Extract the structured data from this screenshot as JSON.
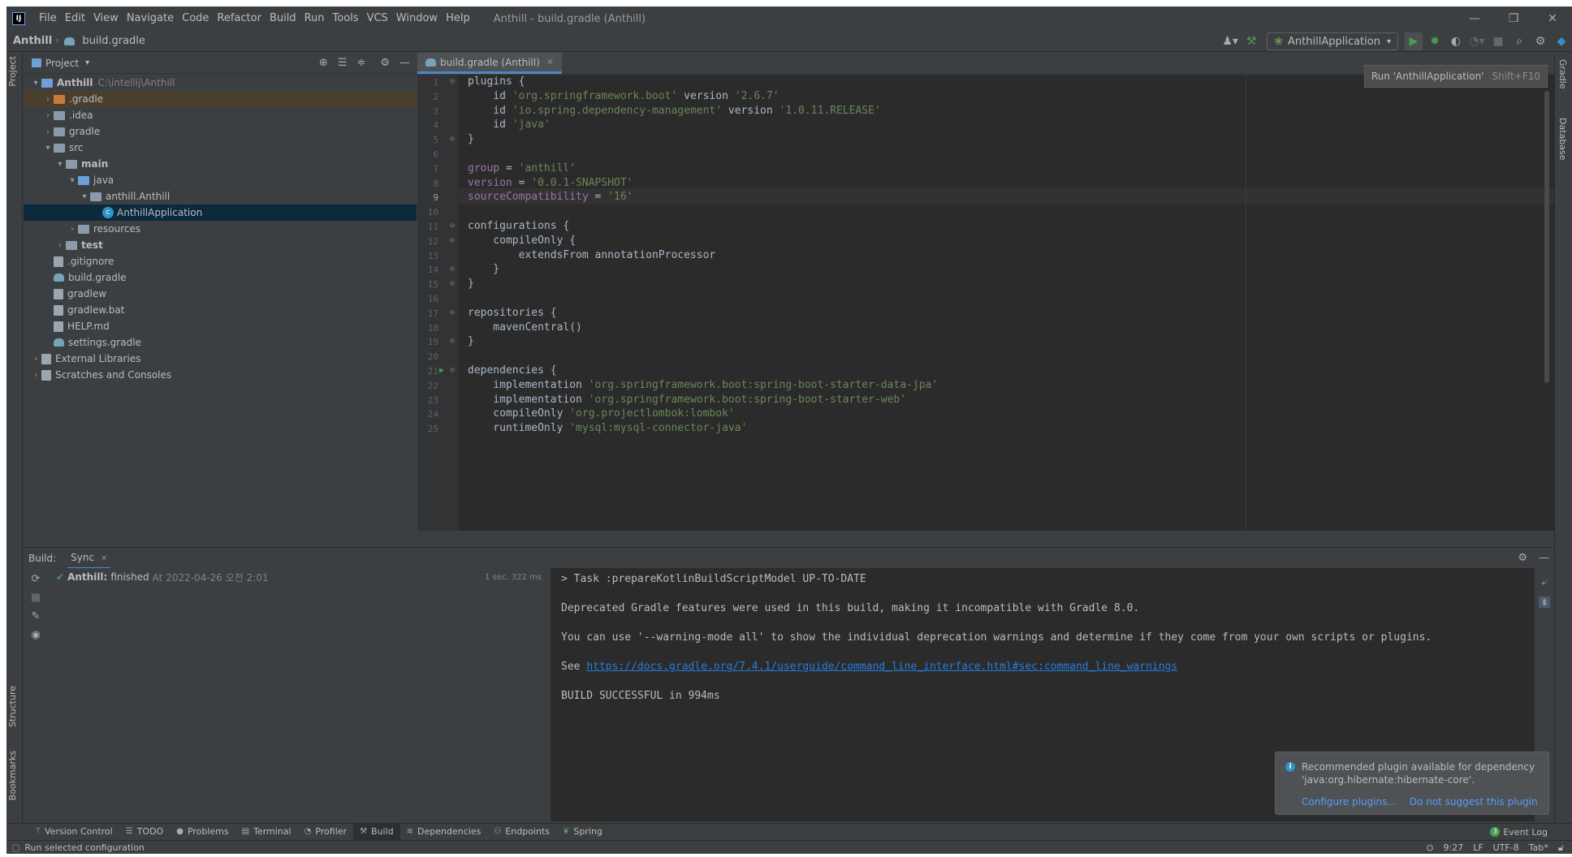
{
  "menubar": {
    "logo": "IJ",
    "items": [
      "File",
      "Edit",
      "View",
      "Navigate",
      "Code",
      "Refactor",
      "Build",
      "Run",
      "Tools",
      "VCS",
      "Window",
      "Help"
    ],
    "window_title": "Anthill - build.gradle (Anthill)",
    "controls": [
      "—",
      "❐",
      "✕"
    ]
  },
  "navbar": {
    "project": "Anthill",
    "file": "build.gradle",
    "run_config": "AnthillApplication"
  },
  "tooltip": {
    "text": "Run 'AnthillApplication'",
    "shortcut": "Shift+F10"
  },
  "left_stripe": [
    "Project",
    "Structure",
    "Bookmarks"
  ],
  "right_stripe": [
    "Gradle",
    "Database"
  ],
  "project_panel": {
    "title": "Project",
    "tree": [
      {
        "label": "Anthill",
        "extra": "C:\\intellij\\Anthill",
        "depth": 0,
        "arrow": "▾",
        "icon": "module",
        "bold": true
      },
      {
        "label": ".gradle",
        "depth": 1,
        "arrow": "›",
        "icon": "folder-orange",
        "hl": true
      },
      {
        "label": ".idea",
        "depth": 1,
        "arrow": "›",
        "icon": "folder"
      },
      {
        "label": "gradle",
        "depth": 1,
        "arrow": "›",
        "icon": "folder"
      },
      {
        "label": "src",
        "depth": 1,
        "arrow": "▾",
        "icon": "folder"
      },
      {
        "label": "main",
        "depth": 2,
        "arrow": "▾",
        "icon": "folder",
        "bold": true
      },
      {
        "label": "java",
        "depth": 3,
        "arrow": "▾",
        "icon": "folder-blue"
      },
      {
        "label": "anthill.Anthill",
        "depth": 4,
        "arrow": "▾",
        "icon": "package"
      },
      {
        "label": "AnthillApplication",
        "depth": 5,
        "arrow": "",
        "icon": "class",
        "selected": true
      },
      {
        "label": "resources",
        "depth": 3,
        "arrow": "›",
        "icon": "folder"
      },
      {
        "label": "test",
        "depth": 2,
        "arrow": "›",
        "icon": "folder",
        "bold": true
      },
      {
        "label": ".gitignore",
        "depth": 1,
        "arrow": "",
        "icon": "file"
      },
      {
        "label": "build.gradle",
        "depth": 1,
        "arrow": "",
        "icon": "gradle"
      },
      {
        "label": "gradlew",
        "depth": 1,
        "arrow": "",
        "icon": "file"
      },
      {
        "label": "gradlew.bat",
        "depth": 1,
        "arrow": "",
        "icon": "file"
      },
      {
        "label": "HELP.md",
        "depth": 1,
        "arrow": "",
        "icon": "file"
      },
      {
        "label": "settings.gradle",
        "depth": 1,
        "arrow": "",
        "icon": "gradle"
      },
      {
        "label": "External Libraries",
        "depth": 0,
        "arrow": "›",
        "icon": "libs"
      },
      {
        "label": "Scratches and Consoles",
        "depth": 0,
        "arrow": "›",
        "icon": "scratch"
      }
    ]
  },
  "editor": {
    "tab": "build.gradle (Anthill)",
    "caret_line": 9,
    "lines": [
      [
        {
          "t": "plugins {"
        }
      ],
      [
        {
          "t": "    id "
        },
        {
          "t": "'org.springframework.boot'",
          "c": "s"
        },
        {
          "t": " version "
        },
        {
          "t": "'2.6.7'",
          "c": "s"
        }
      ],
      [
        {
          "t": "    id "
        },
        {
          "t": "'io.spring.dependency-management'",
          "c": "s"
        },
        {
          "t": " version "
        },
        {
          "t": "'1.0.11.RELEASE'",
          "c": "s"
        }
      ],
      [
        {
          "t": "    id "
        },
        {
          "t": "'java'",
          "c": "s"
        }
      ],
      [
        {
          "t": "}"
        }
      ],
      [],
      [
        {
          "t": "group",
          "c": "p"
        },
        {
          "t": " = "
        },
        {
          "t": "'anthill'",
          "c": "s"
        }
      ],
      [
        {
          "t": "version",
          "c": "p"
        },
        {
          "t": " = "
        },
        {
          "t": "'0.0.1-SNAPSHOT'",
          "c": "s"
        }
      ],
      [
        {
          "t": "sourceCompatibility",
          "c": "p"
        },
        {
          "t": " = "
        },
        {
          "t": "'16'",
          "c": "s"
        }
      ],
      [],
      [
        {
          "t": "configurations {"
        }
      ],
      [
        {
          "t": "    compileOnly {"
        }
      ],
      [
        {
          "t": "        extendsFrom annotationProcessor"
        }
      ],
      [
        {
          "t": "    }"
        }
      ],
      [
        {
          "t": "}"
        }
      ],
      [],
      [
        {
          "t": "repositories {"
        }
      ],
      [
        {
          "t": "    mavenCentral()"
        }
      ],
      [
        {
          "t": "}"
        }
      ],
      [],
      [
        {
          "t": "dependencies {"
        }
      ],
      [
        {
          "t": "    implementation "
        },
        {
          "t": "'org.springframework.boot:spring-boot-starter-data-jpa'",
          "c": "s"
        }
      ],
      [
        {
          "t": "    implementation "
        },
        {
          "t": "'org.springframework.boot:spring-boot-starter-web'",
          "c": "s"
        }
      ],
      [
        {
          "t": "    compileOnly "
        },
        {
          "t": "'org.projectlombok:lombok'",
          "c": "s"
        }
      ],
      [
        {
          "t": "    runtimeOnly "
        },
        {
          "t": "'mysql:mysql-connector-java'",
          "c": "s"
        }
      ]
    ]
  },
  "build": {
    "label": "Build:",
    "tab": "Sync",
    "tree_item": {
      "name": "Anthill:",
      "status": "finished",
      "time": "At 2022-04-26 오전 2:01",
      "duration": "1 sec, 322 ms"
    },
    "console": [
      "> Task :prepareKotlinBuildScriptModel UP-TO-DATE",
      "",
      "Deprecated Gradle features were used in this build, making it incompatible with Gradle 8.0.",
      "",
      "You can use '--warning-mode all' to show the individual deprecation warnings and determine if they come from your own scripts or plugins.",
      "",
      "See ",
      "",
      "BUILD SUCCESSFUL in 994ms"
    ],
    "link": "https://docs.gradle.org/7.4.1/userguide/command_line_interface.html#sec:command_line_warnings"
  },
  "notification": {
    "text": "Recommended plugin available for dependency 'java:org.hibernate:hibernate-core'.",
    "action1": "Configure plugins...",
    "action2": "Do not suggest this plugin"
  },
  "bottom_tabs": [
    "Version Control",
    "TODO",
    "Problems",
    "Terminal",
    "Profiler",
    "Build",
    "Dependencies",
    "Endpoints",
    "Spring"
  ],
  "event_log": {
    "count": "3",
    "label": "Event Log"
  },
  "status": {
    "left": "Run selected configuration",
    "position": "9:27",
    "line_sep": "LF",
    "encoding": "UTF-8",
    "indent": "Tab*"
  }
}
